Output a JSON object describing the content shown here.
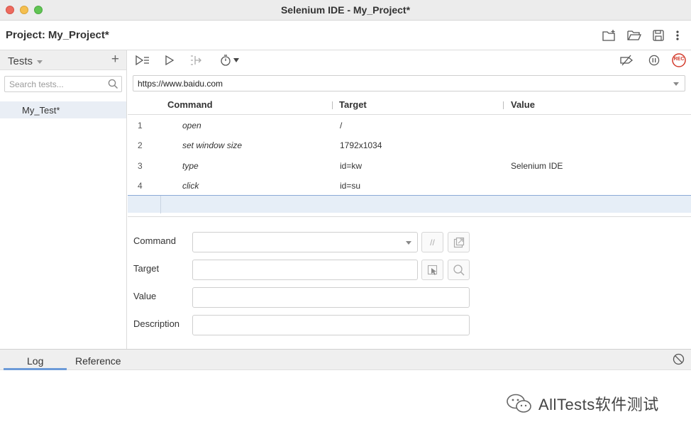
{
  "window": {
    "title": "Selenium IDE - My_Project*"
  },
  "project": {
    "label": "Project:",
    "name": "My_Project*"
  },
  "sidebar": {
    "dropdown_label": "Tests",
    "search_placeholder": "Search tests...",
    "tests": [
      {
        "name": "My_Test*",
        "selected": true
      }
    ]
  },
  "toolbar": {
    "buttons": [
      "run-all-tests-icon",
      "run-current-test-icon",
      "step-over-icon",
      "speed-timer-icon",
      "disable-breakpoints-icon",
      "pause-on-exceptions-icon",
      "record-icon"
    ],
    "record_label": "REC"
  },
  "url": {
    "value": "https://www.baidu.com"
  },
  "table": {
    "headers": {
      "command": "Command",
      "target": "Target",
      "value": "Value"
    },
    "rows": [
      {
        "num": "1",
        "command": "open",
        "target": "/",
        "value": ""
      },
      {
        "num": "2",
        "command": "set window size",
        "target": "1792x1034",
        "value": ""
      },
      {
        "num": "3",
        "command": "type",
        "target": "id=kw",
        "value": "Selenium IDE"
      },
      {
        "num": "4",
        "command": "click",
        "target": "id=su",
        "value": ""
      }
    ]
  },
  "editor": {
    "command_label": "Command",
    "target_label": "Target",
    "value_label": "Value",
    "description_label": "Description",
    "comment_toggle": "//"
  },
  "bottom": {
    "tab_log": "Log",
    "tab_reference": "Reference"
  },
  "watermark": {
    "text": "AllTests软件测试"
  },
  "colors": {
    "accent": "#6d9bd8",
    "record": "#d33b2c",
    "selected_row": "#e6eef7"
  }
}
